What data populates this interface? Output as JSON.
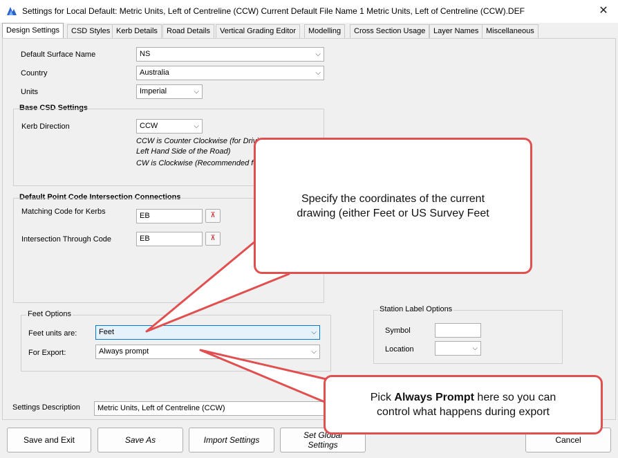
{
  "window": {
    "title": "Settings for Local Default:  Metric Units, Left of Centreline (CCW) Current Default File Name 1 Metric Units, Left of Centreline (CCW).DEF",
    "close_glyph": "✕"
  },
  "tabs": [
    {
      "label": "Design Settings"
    },
    {
      "label": "CSD Styles"
    },
    {
      "label": "Kerb Details"
    },
    {
      "label": "Road Details"
    },
    {
      "label": "Vertical Grading Editor"
    },
    {
      "label": "Modelling"
    },
    {
      "label": "Cross Section Usage"
    },
    {
      "label": "Layer Names"
    },
    {
      "label": "Miscellaneous"
    }
  ],
  "general": {
    "default_surface_label": "Default Surface Name",
    "default_surface_value": "NS",
    "country_label": "Country",
    "country_value": "Australia",
    "units_label": "Units",
    "units_value": "Imperial"
  },
  "base_csd": {
    "heading": "Base CSD Settings",
    "kerb_direction_label": "Kerb Direction",
    "kerb_direction_value": "CCW",
    "note_line1": "CCW is Counter Clockwise (for Drivi",
    "note_line2": "Left Hand Side of the Road)",
    "note_line3": "CW is Clockwise (Recommended for"
  },
  "point_code": {
    "heading": "Default Point Code Intersection Connections",
    "matching_label": "Matching Code for Kerbs",
    "matching_value": "EB",
    "through_label": "Intersection Through Code",
    "through_value": "EB"
  },
  "feet_options": {
    "heading": "Feet Options",
    "units_label": "Feet units are:",
    "units_value": "Feet",
    "export_label": "For Export:",
    "export_value": "Always prompt"
  },
  "station_label": {
    "heading": "Station Label Options",
    "symbol_label": "Symbol",
    "symbol_value": "",
    "location_label": "Location",
    "location_value": ""
  },
  "settings_description": {
    "label": "Settings Description",
    "value": "Metric Units, Left of Centreline (CCW)"
  },
  "buttons": {
    "save_exit": "Save and Exit",
    "save_as": "Save As",
    "import": "Import Settings",
    "set_global_line1": "Set Global",
    "set_global_line2": "Settings",
    "cancel": "Cancel"
  },
  "callouts": {
    "top_line1": "Specify the coordinates of the current",
    "top_line2": "drawing (either Feet or US Survey Feet",
    "bottom_pre": "Pick ",
    "bottom_bold": "Always Prompt",
    "bottom_post": " here so you can",
    "bottom_line2": "control what happens during export"
  },
  "colors": {
    "callout_border": "#e05050",
    "focus_blue": "#0078d7"
  },
  "icons": {
    "dropdown": "⌵",
    "pick": "⊼"
  }
}
